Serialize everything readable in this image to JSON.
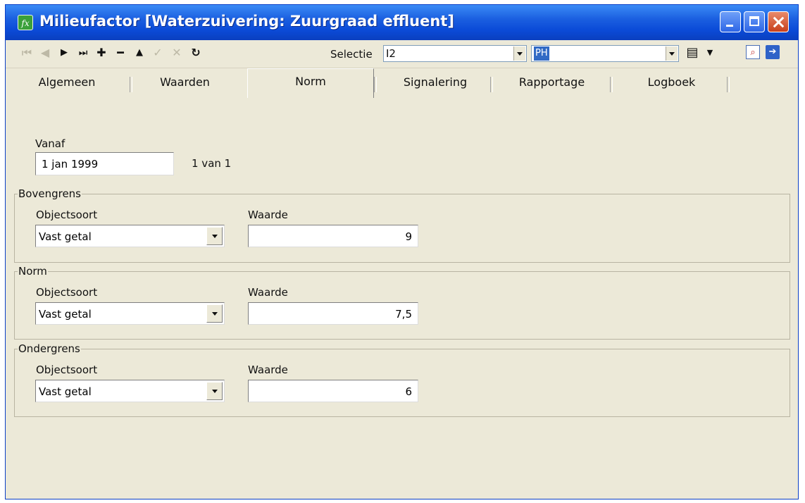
{
  "window": {
    "title": "Milieufactor [Waterzuivering: Zuurgraad effluent]",
    "app_icon_glyph": "fx"
  },
  "toolbar": {
    "icons": [
      "first-record-icon",
      "previous-record-icon",
      "next-record-icon",
      "last-record-icon",
      "add-record-icon",
      "delete-record-icon",
      "up-icon",
      "confirm-icon",
      "cancel-icon",
      "refresh-icon",
      "document-icon",
      "zoom-page-icon",
      "exit-icon"
    ],
    "selectie_label": "Selectie",
    "selectie_value": "I2",
    "filter_value": "PH"
  },
  "tabs": [
    {
      "label": "Algemeen",
      "active": false
    },
    {
      "label": "Waarden",
      "active": false
    },
    {
      "label": "Norm",
      "active": true
    },
    {
      "label": "Signalering",
      "active": false
    },
    {
      "label": "Rapportage",
      "active": false
    },
    {
      "label": "Logboek",
      "active": false
    }
  ],
  "norm": {
    "vanaf_label": "Vanaf",
    "vanaf_value": "1 jan 1999",
    "record_counter": "1 van 1",
    "groups": [
      {
        "title": "Bovengrens",
        "objectsoort_label": "Objectsoort",
        "objectsoort_value": "Vast getal",
        "waarde_label": "Waarde",
        "waarde_value": "9"
      },
      {
        "title": "Norm",
        "objectsoort_label": "Objectsoort",
        "objectsoort_value": "Vast getal",
        "waarde_label": "Waarde",
        "waarde_value": "7,5"
      },
      {
        "title": "Ondergrens",
        "objectsoort_label": "Objectsoort",
        "objectsoort_value": "Vast getal",
        "waarde_label": "Waarde",
        "waarde_value": "6"
      }
    ]
  },
  "colors": {
    "titlebar": "#0b4bd8",
    "window_bg": "#ece9d8",
    "selection_bg": "#316ac5"
  }
}
